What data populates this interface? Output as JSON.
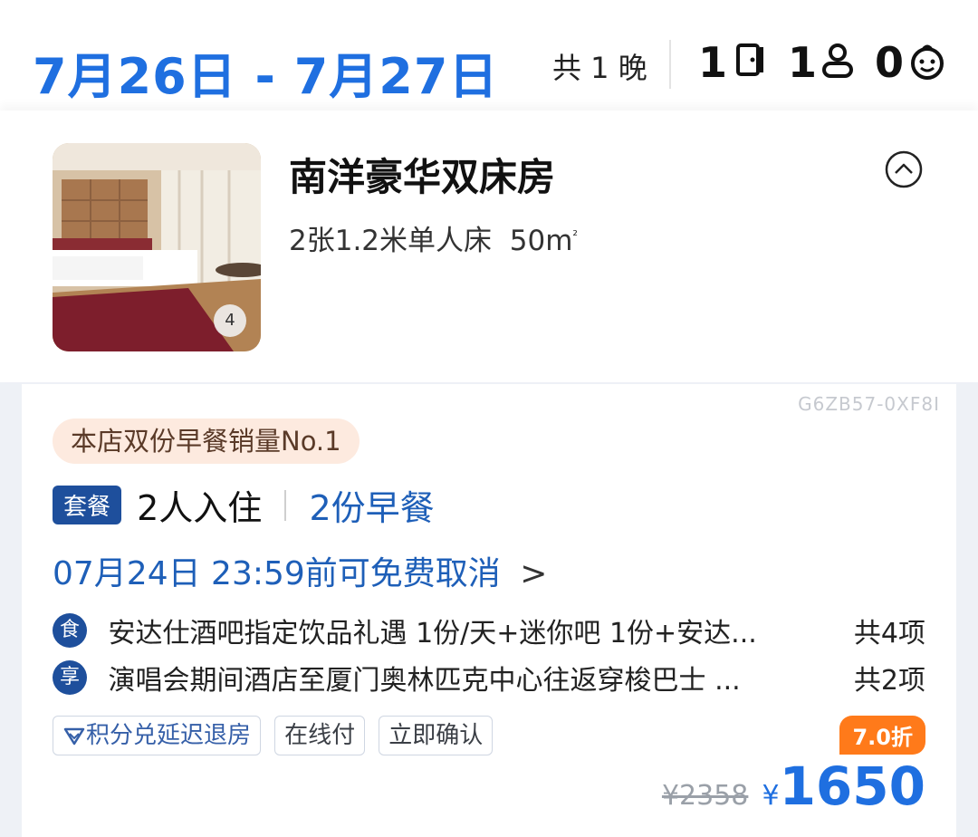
{
  "header": {
    "date_range": "7月26日 - 7月27日",
    "nights": "共 1 晚",
    "rooms_count": "1",
    "adults_count": "1",
    "children_count": "0"
  },
  "room": {
    "title": "南洋豪华双床房",
    "beds": "2张1.2米单人床",
    "area": "50m",
    "area_unit_sup": "²",
    "photo_count": "4"
  },
  "rate": {
    "code": "G6ZB57-0XF8I",
    "sales_tag": "本店双份早餐销量No.1",
    "package_badge": "套餐",
    "guests": "2人入住",
    "breakfast": "2份早餐",
    "cancellation": "07月24日 23:59前可免费取消",
    "perks": [
      {
        "icon": "食",
        "icon_name": "food-icon",
        "text": "安达仕酒吧指定饮品礼遇 1份/天+迷你吧 1份+安达...",
        "total": "共4项"
      },
      {
        "icon": "享",
        "icon_name": "enjoy-icon",
        "text": "演唱会期间酒店至厦门奥林匹克中心往返穿梭巴士 ...",
        "total": "共2项"
      }
    ],
    "features": [
      "积分兑延迟退房",
      "在线付",
      "立即确认"
    ],
    "discount": "7.0折",
    "original_price": "¥2358",
    "currency": "¥",
    "price": "1650"
  },
  "colors": {
    "accent_blue": "#1f6fe0",
    "badge_navy": "#1e4f9c",
    "discount_orange": "#ff7a1a"
  }
}
